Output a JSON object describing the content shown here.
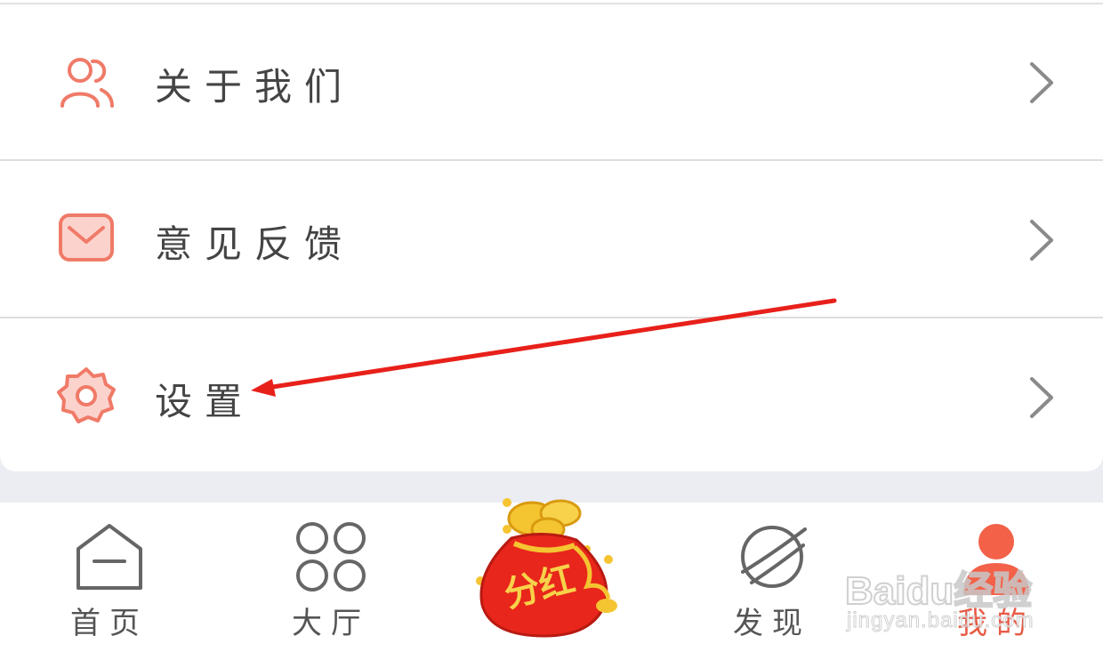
{
  "menu": {
    "items": [
      {
        "label": "关于我们",
        "icon": "users-icon"
      },
      {
        "label": "意见反馈",
        "icon": "mail-icon"
      },
      {
        "label": "设置",
        "icon": "gear-icon"
      }
    ]
  },
  "tabs": [
    {
      "label": "首页",
      "icon": "home-icon"
    },
    {
      "label": "大厅",
      "icon": "grid-icon"
    },
    {
      "label": "分红",
      "icon": "red-packet-bag-icon"
    },
    {
      "label": "发现",
      "icon": "planet-icon"
    },
    {
      "label": "我的",
      "icon": "person-icon",
      "active": true
    }
  ],
  "watermark": {
    "line1": "Baidu经验",
    "line2": "jingyan.baidu.com"
  },
  "colors": {
    "accent": "#e85a45",
    "icon_light": "#f28a7a",
    "text": "#444444",
    "annotation_arrow": "#e8201a"
  }
}
